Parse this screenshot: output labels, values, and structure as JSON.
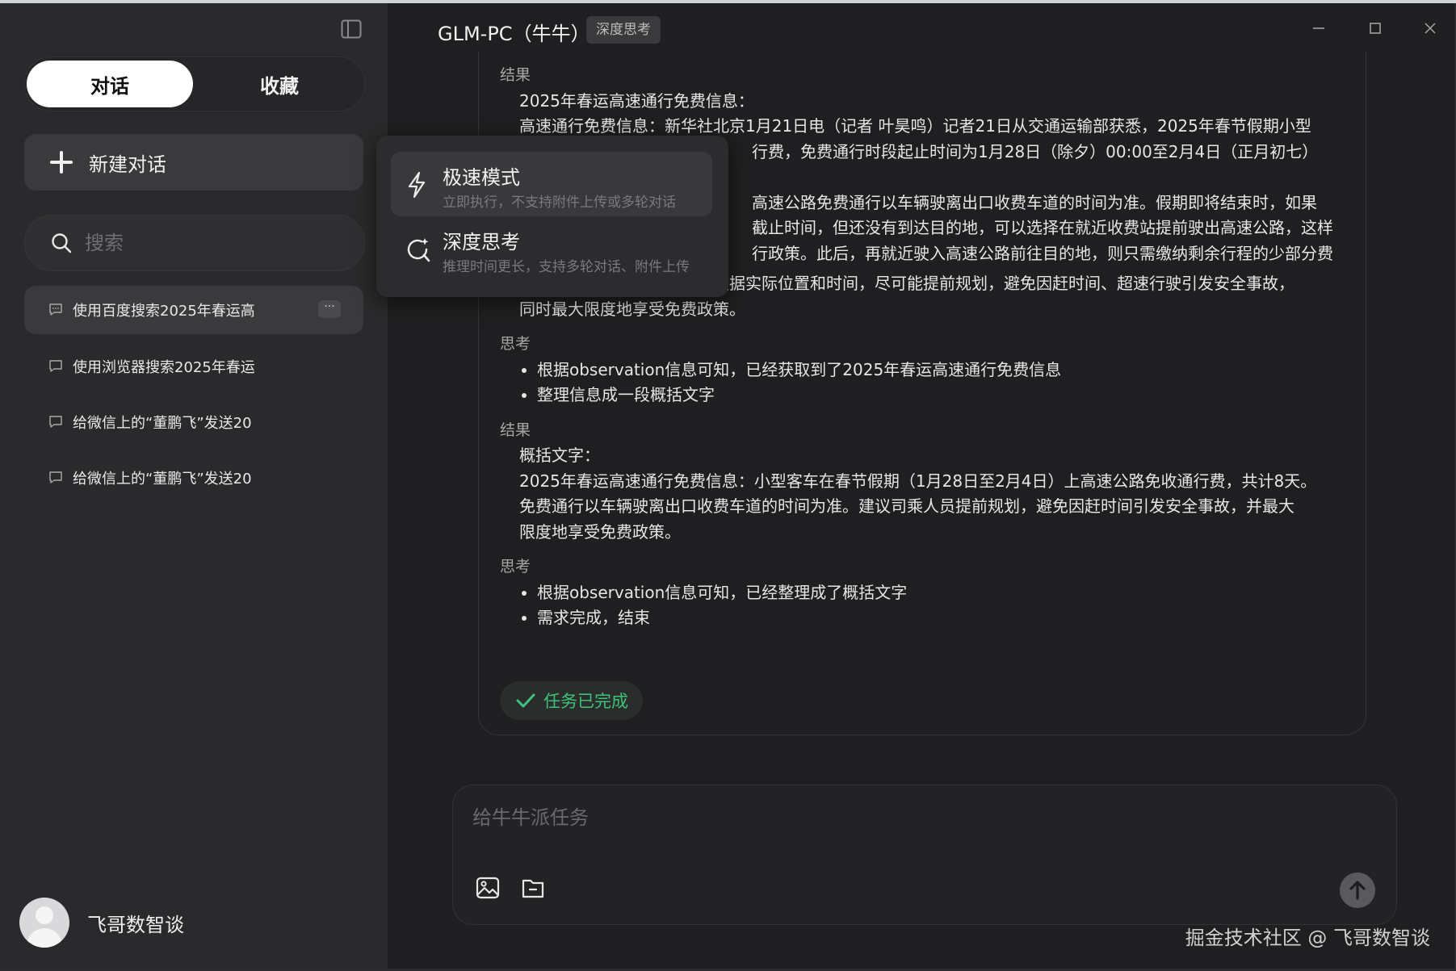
{
  "window": {
    "title": "GLM-PC（牛牛）",
    "mode_badge": "深度思考"
  },
  "sidebar": {
    "tabs": [
      {
        "label": "对话",
        "active": true
      },
      {
        "label": "收藏",
        "active": false
      }
    ],
    "new_chat_label": "新建对话",
    "search_placeholder": "搜索",
    "conversations": [
      {
        "title": "使用百度搜索2025年春运高",
        "active": true,
        "more": "···"
      },
      {
        "title": "使用浏览器搜索2025年春运",
        "active": false
      },
      {
        "title": "给微信上的“董鹏飞”发送20",
        "active": false
      },
      {
        "title": "给微信上的“董鹏飞”发送20",
        "active": false
      }
    ],
    "user_name": "飞哥数智谈"
  },
  "mode_menu": {
    "items": [
      {
        "title": "极速模式",
        "subtitle": "立即执行，不支持附件上传或多轮对话",
        "icon": "lightning-icon",
        "highlighted": true
      },
      {
        "title": "深度思考",
        "subtitle": "推理时间更长，支持多轮对话、附件上传",
        "icon": "deep-think-icon",
        "highlighted": false
      }
    ]
  },
  "chat": {
    "result1": {
      "heading": "结果",
      "line1": "2025年春运高速通行免费信息：",
      "line2": "高速通行免费信息：新华社北京1月21日电（记者 叶昊鸣）记者21日从交通运输部获悉，2025年春节假期小型",
      "line3": "行费，免费通行时段起止时间为1月28日（除夕）00:00至2月4日（正月初七）",
      "line4": "高速公路免费通行以车辆驶离出口收费车道的时间为准。假期即将结束时，如果",
      "line5": "截止时间，但还没有到达目的地，可以选择在就近收费站提前驶出高速公路，这样",
      "line6": "行政策。此后，再就近驶入高速公路前往目的地，则只需缴纳剩余行程的少部分费",
      "line7": "这位负责人建议，司乘人员根据实际位置和时间，尽可能提前规划，避免因赶时间、超速行驶引发安全事故，",
      "line8": "同时最大限度地享受免费政策。"
    },
    "think1": {
      "heading": "思考",
      "bullets": [
        "根据observation信息可知，已经获取到了2025年春运高速通行免费信息",
        "整理信息成一段概括文字"
      ]
    },
    "result2": {
      "heading": "结果",
      "line1": "概括文字：",
      "line2": "2025年春运高速通行免费信息：小型客车在春节假期（1月28日至2月4日）上高速公路免收通行费，共计8天。",
      "line3": "免费通行以车辆驶离出口收费车道的时间为准。建议司乘人员提前规划，避免因赶时间引发安全事故，并最大",
      "line4": "限度地享受免费政策。"
    },
    "think2": {
      "heading": "思考",
      "bullets": [
        "根据observation信息可知，已经整理成了概括文字",
        "需求完成，结束"
      ]
    },
    "status": "任务已完成"
  },
  "composer": {
    "placeholder": "给牛牛派任务"
  },
  "watermark": "掘金技术社区 @ 飞哥数智谈",
  "colors": {
    "background": "#1f1f21",
    "sidebar": "#2a2a2c",
    "success": "#3ec27a"
  }
}
